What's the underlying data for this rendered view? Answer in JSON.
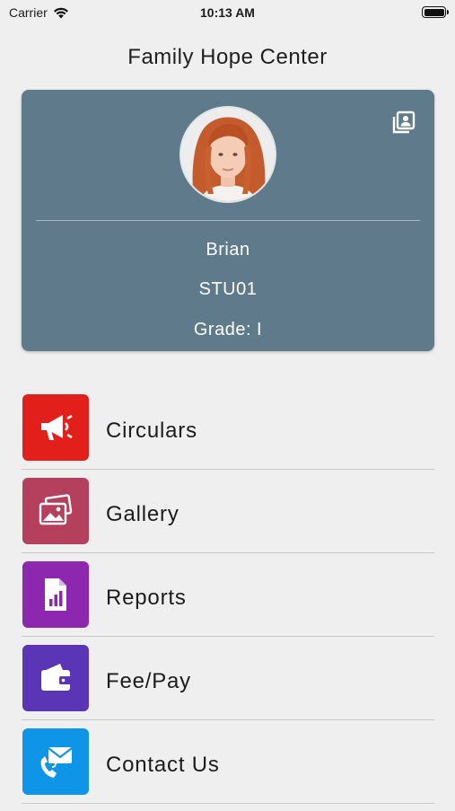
{
  "status_bar": {
    "carrier": "Carrier",
    "time": "10:13 AM"
  },
  "app": {
    "title": "Family Hope Center"
  },
  "profile": {
    "name": "Brian",
    "student_id": "STU01",
    "grade": "Grade: I",
    "card_color": "#5f7b8b"
  },
  "menu": {
    "items": [
      {
        "label": "Circulars",
        "icon": "megaphone-icon",
        "color": "#e21f1b"
      },
      {
        "label": "Gallery",
        "icon": "photos-icon",
        "color": "#b5405e"
      },
      {
        "label": "Reports",
        "icon": "report-icon",
        "color": "#8e27b0"
      },
      {
        "label": "Fee/Pay",
        "icon": "wallet-icon",
        "color": "#5a35b5"
      },
      {
        "label": "Contact Us",
        "icon": "contact-mail-icon",
        "color": "#0f95e8"
      }
    ]
  }
}
